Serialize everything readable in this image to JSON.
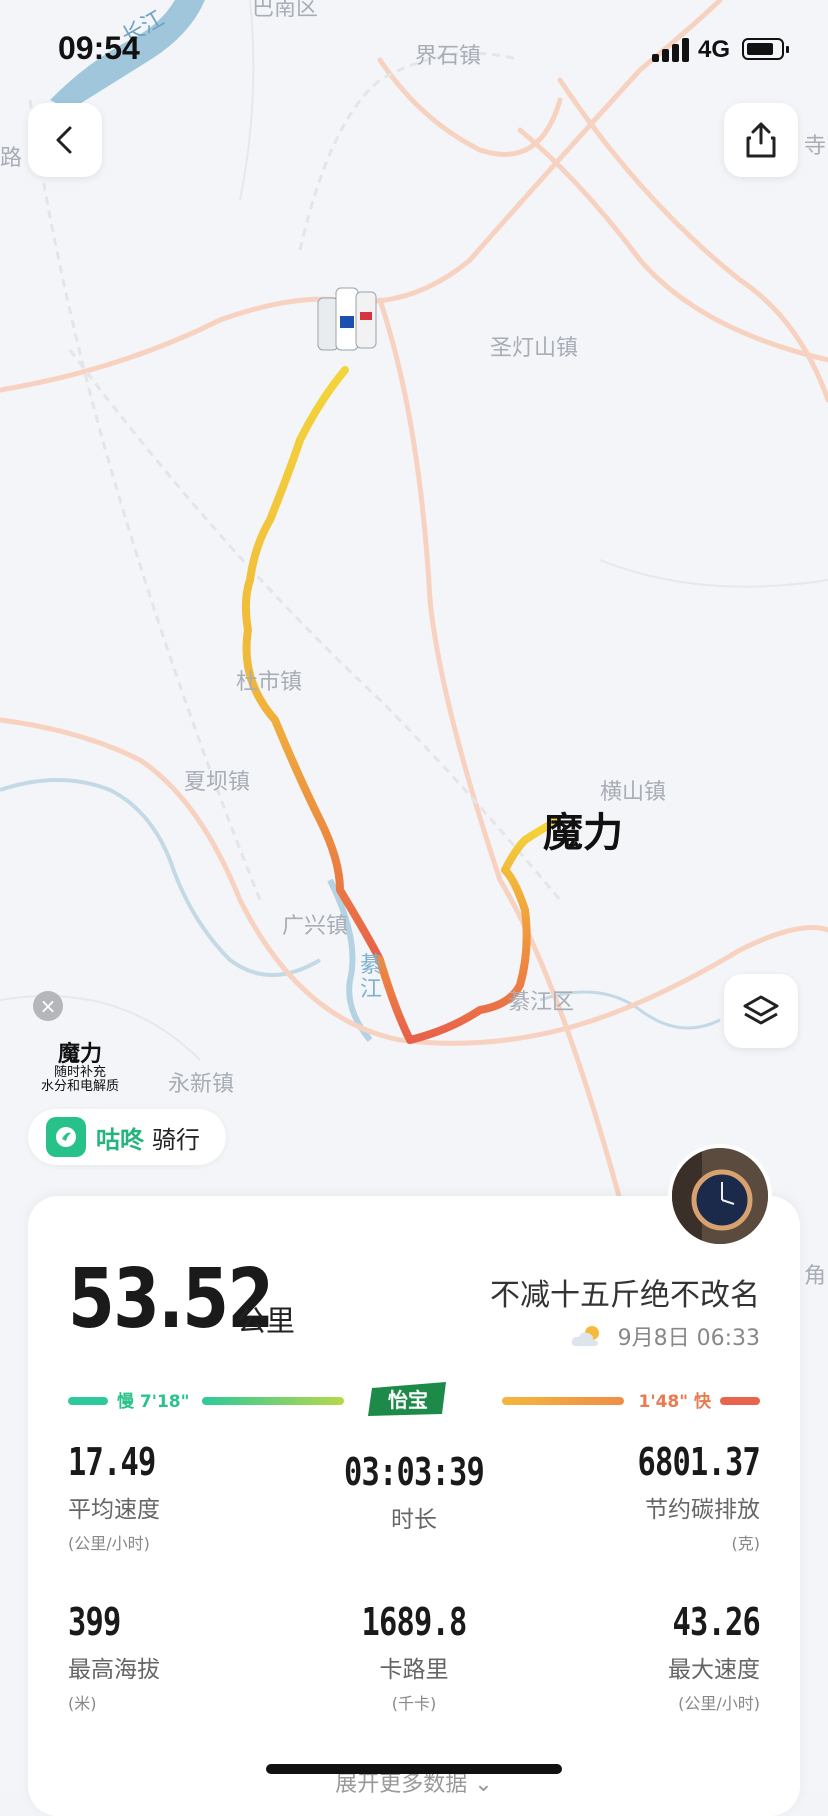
{
  "status_bar": {
    "time": "09:54",
    "network": "4G",
    "battery_icon": "battery-icon",
    "signal_icon": "signal-icon"
  },
  "map": {
    "labels": {
      "river_top": "长江",
      "jieshi": "界石镇",
      "shengdengshan": "圣灯山镇",
      "dushi": "杜市镇",
      "xiaba": "夏坝镇",
      "hengshan": "横山镇",
      "guangxing": "广兴镇",
      "qijiang_river": "綦江",
      "qijiang_district": "綦江区",
      "yongxin": "永新镇",
      "nanqu_top": "巴南区",
      "lu_left": "路",
      "si_right": "寺",
      "jiao_right": "角"
    },
    "route_brand": "魔力",
    "colors": {
      "route_slow": "#f5d53a",
      "route_mid": "#f0a93a",
      "route_fast": "#e8604a",
      "road": "#f7c7b0",
      "water": "#9fc6da"
    }
  },
  "ad": {
    "title": "魔力",
    "line1": "随时补充",
    "line2": "水分和电解质",
    "close_icon": "close-icon"
  },
  "brand": {
    "name": "咕咚",
    "activity": "骑行",
    "logo_icon": "codoon-logo-icon"
  },
  "summary": {
    "distance": "53.52",
    "distance_unit": "公里",
    "title": "不减十五斤绝不改名",
    "date": "9月8日 06:33",
    "weather_icon": "partly-cloudy-icon"
  },
  "pace": {
    "slow": "慢 7'18\"",
    "fast": "1'48\" 快",
    "sponsor": "怡宝"
  },
  "stats": [
    {
      "value": "17.49",
      "label": "平均速度",
      "unit": "(公里/小时)"
    },
    {
      "value": "03:03:39",
      "label": "时长",
      "unit": ""
    },
    {
      "value": "6801.37",
      "label": "节约碳排放",
      "unit": "(克)"
    },
    {
      "value": "399",
      "label": "最高海拔",
      "unit": "(米)"
    },
    {
      "value": "1689.8",
      "label": "卡路里",
      "unit": "(千卡)"
    },
    {
      "value": "43.26",
      "label": "最大速度",
      "unit": "(公里/小时)"
    }
  ],
  "more": "展开更多数据"
}
